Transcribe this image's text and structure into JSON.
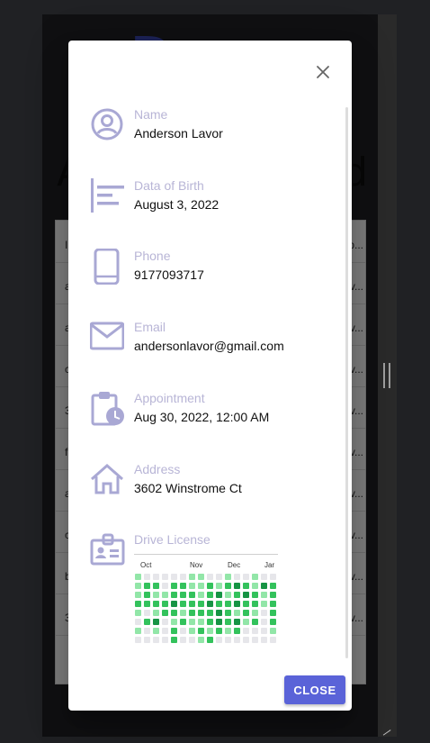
{
  "background": {
    "logo_letter": "D",
    "title_left": "A",
    "title_right": "d",
    "rows": [
      {
        "c1": "I",
        "c2": "p..."
      },
      {
        "c1": "a",
        "c2": "v..."
      },
      {
        "c1": "a",
        "c2": "v..."
      },
      {
        "c1": "c",
        "c2": "v..."
      },
      {
        "c1": "3",
        "c2": "v..."
      },
      {
        "c1": "f",
        "c2": "v..."
      },
      {
        "c1": "a",
        "c2": "v..."
      },
      {
        "c1": "c",
        "c2": "v..."
      },
      {
        "c1": "b",
        "c2": "v..."
      },
      {
        "c1": "3",
        "c2": "v..."
      }
    ]
  },
  "dialog": {
    "fields": [
      {
        "label": "Name",
        "value": "Anderson Lavor",
        "icon": "account-circle-icon"
      },
      {
        "label": "Data of Birth",
        "value": "August 3, 2022",
        "icon": "align-left-icon"
      },
      {
        "label": "Phone",
        "value": "9177093717",
        "icon": "smartphone-icon"
      },
      {
        "label": "Email",
        "value": "andersonlavor@gmail.com",
        "icon": "mail-icon"
      },
      {
        "label": "Appointment",
        "value": "Aug 30, 2022, 12:00 AM",
        "icon": "clipboard-clock-icon"
      },
      {
        "label": "Address",
        "value": "3602 Winstrome Ct",
        "icon": "home-icon"
      }
    ],
    "license": {
      "label": "Drive License",
      "icon": "badge-icon",
      "months": [
        "Oct",
        "Nov",
        "Dec",
        "Jar"
      ],
      "grid": [
        [
          1,
          0,
          0,
          0,
          0,
          0,
          1,
          1,
          0,
          0,
          1,
          0,
          0,
          1,
          0,
          0
        ],
        [
          1,
          2,
          2,
          0,
          2,
          2,
          1,
          1,
          2,
          1,
          2,
          3,
          2,
          1,
          3,
          2
        ],
        [
          1,
          2,
          1,
          1,
          2,
          2,
          2,
          1,
          2,
          3,
          1,
          2,
          3,
          2,
          1,
          2
        ],
        [
          2,
          2,
          2,
          2,
          3,
          2,
          2,
          2,
          3,
          2,
          2,
          3,
          2,
          2,
          1,
          2
        ],
        [
          1,
          0,
          1,
          2,
          2,
          1,
          2,
          2,
          2,
          3,
          2,
          1,
          2,
          1,
          0,
          2
        ],
        [
          0,
          2,
          3,
          0,
          1,
          2,
          1,
          1,
          2,
          3,
          2,
          3,
          1,
          2,
          0,
          2
        ],
        [
          1,
          0,
          1,
          0,
          2,
          0,
          1,
          2,
          1,
          2,
          1,
          2,
          0,
          0,
          0,
          1
        ],
        [
          0,
          0,
          0,
          0,
          2,
          0,
          0,
          1,
          2,
          0,
          0,
          0,
          0,
          0,
          0,
          0
        ]
      ]
    },
    "close_label": "CLOSE"
  },
  "colors": {
    "accent": "#5a63d8",
    "icon": "#a9a8d4",
    "label": "#b8b5d6",
    "heat0": "#e6e6ea",
    "heat1": "#92e6a8",
    "heat2": "#33c25c",
    "heat3": "#169444"
  }
}
